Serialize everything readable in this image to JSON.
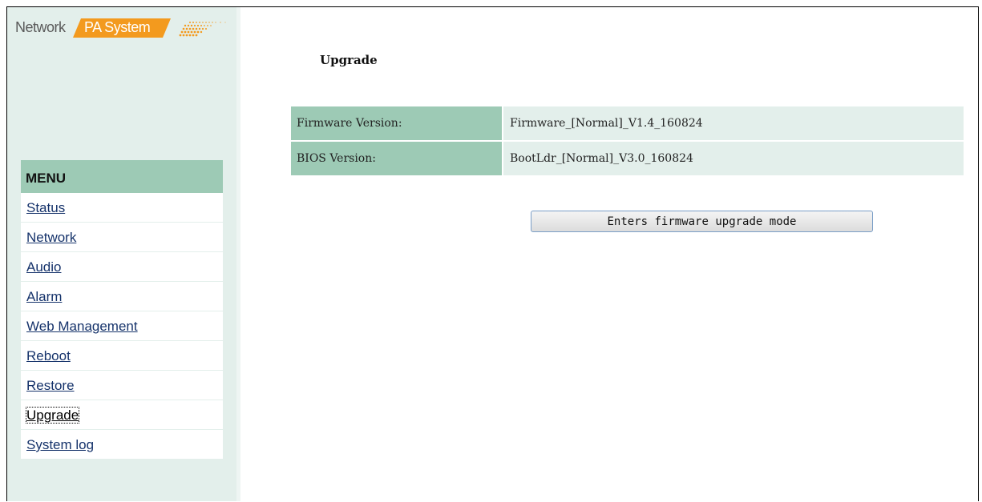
{
  "logo": {
    "word1": "Network",
    "word2": "PA System"
  },
  "menu": {
    "header": "MENU",
    "items": [
      {
        "label": "Status",
        "active": false
      },
      {
        "label": "Network",
        "active": false
      },
      {
        "label": "Audio",
        "active": false
      },
      {
        "label": "Alarm",
        "active": false
      },
      {
        "label": "Web Management",
        "active": false
      },
      {
        "label": "Reboot",
        "active": false
      },
      {
        "label": "Restore",
        "active": false
      },
      {
        "label": "Upgrade",
        "active": true
      },
      {
        "label": "System log",
        "active": false
      }
    ]
  },
  "main": {
    "title": "Upgrade",
    "rows": [
      {
        "label": "Firmware Version:",
        "value": "Firmware_[Normal]_V1.4_160824"
      },
      {
        "label": "BIOS Version:",
        "value": "BootLdr_[Normal]_V3.0_160824"
      }
    ],
    "button_label": "Enters firmware upgrade mode"
  },
  "colors": {
    "sidebar_bg": "#e3efeb",
    "accent_green": "#9dcab5",
    "logo_orange": "#f39a1e",
    "link": "#16336b"
  }
}
